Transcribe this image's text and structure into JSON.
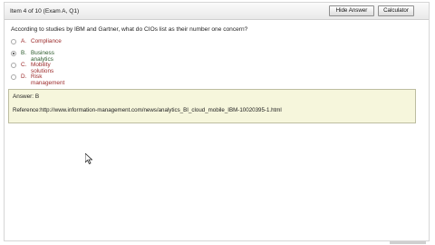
{
  "header": {
    "item_label": "Item 4 of 10  (Exam A, Q1)",
    "hide_answer_label": "Hide Answer",
    "calculator_label": "Calculator"
  },
  "question": {
    "text": "According to studies by IBM and Gartner, what do CIOs list as their number one concern?"
  },
  "options": [
    {
      "letter": "A.",
      "text": "Compliance",
      "selected": false
    },
    {
      "letter": "B.",
      "text": "Business analytics",
      "selected": true
    },
    {
      "letter": "C.",
      "text": "Mobility solutions",
      "selected": false
    },
    {
      "letter": "D.",
      "text": "Risk management",
      "selected": false
    }
  ],
  "answer": {
    "answer_text": "Answer: B",
    "reference_text": "Reference:http://www.information-management.com/news/analytics_BI_cloud_mobile_IBM-10020395-1.html"
  },
  "colors": {
    "option_text": "#9b2a2a",
    "answer_bg": "#f6f6dc"
  }
}
